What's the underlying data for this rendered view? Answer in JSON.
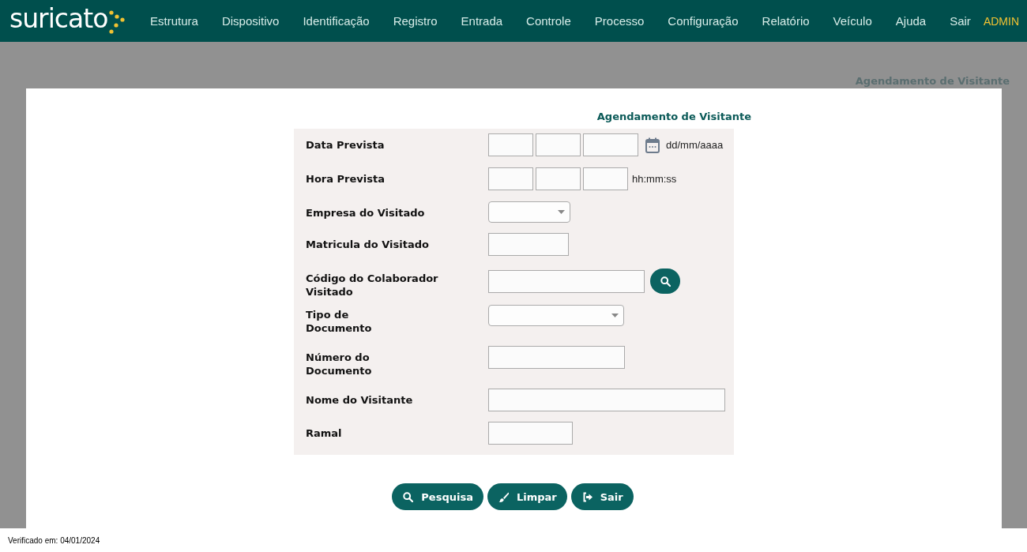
{
  "header": {
    "logo": "suricato",
    "menu": [
      "Estrutura",
      "Dispositivo",
      "Identificação",
      "Registro",
      "Entrada",
      "Controle",
      "Processo",
      "Configuração",
      "Relatório",
      "Veículo",
      "Ajuda",
      "Sair"
    ],
    "user": "ADMIN"
  },
  "page_title": "Agendamento de Visitante",
  "dialog": {
    "title": "Agendamento de Visitante",
    "fields": [
      {
        "label": "Data Prevista",
        "kind": "date",
        "hint": "dd/mm/aaaa"
      },
      {
        "label": "Hora Prevista",
        "kind": "time",
        "hint": "hh:mm:ss"
      },
      {
        "label": "Empresa do Visitado",
        "kind": "select"
      },
      {
        "label": "Matricula do Visitado",
        "kind": "text"
      },
      {
        "label": "Código do Colaborador Visitado",
        "kind": "lookup"
      },
      {
        "label": "Tipo de Documento",
        "kind": "select"
      },
      {
        "label": "Número do Documento",
        "kind": "text"
      },
      {
        "label": "Nome do Visitante",
        "kind": "text"
      },
      {
        "label": "Ramal",
        "kind": "text"
      }
    ],
    "buttons": [
      {
        "label": "Pesquisa",
        "kind": "search"
      },
      {
        "label": "Limpar",
        "kind": "clear"
      },
      {
        "label": "Sair",
        "kind": "exit"
      }
    ]
  },
  "footer": "Verificado em: 04/01/2024"
}
